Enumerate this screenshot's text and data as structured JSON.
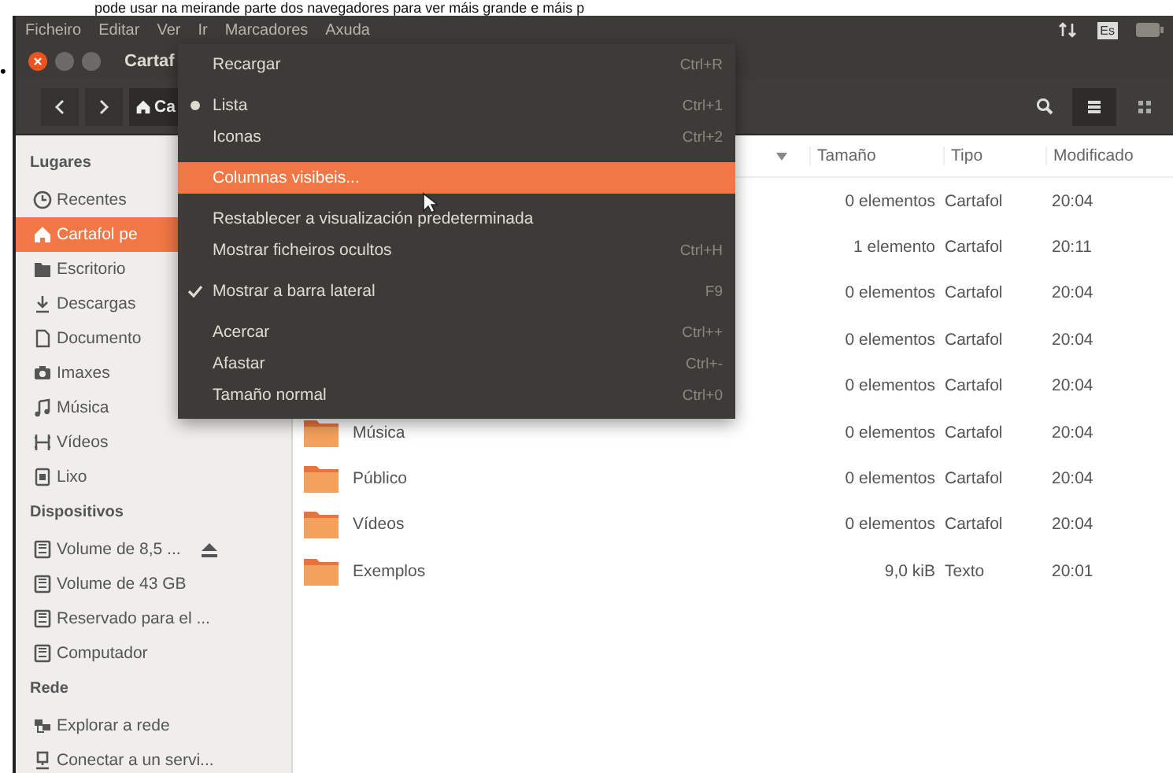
{
  "page_caption": "pode usar na meirande parte dos navegadores para ver máis grande e máis p",
  "bullet": "•",
  "menubar": {
    "items": [
      "Ficheiro",
      "Editar",
      "Ver",
      "Ir",
      "Marcadores",
      "Axuda"
    ],
    "keyboard_layout": "Es"
  },
  "window": {
    "title": "Cartaf"
  },
  "toolbar": {
    "path_button": "Ca",
    "view_buttons": [
      {
        "kind": "list",
        "selected": true
      },
      {
        "kind": "grid",
        "selected": false
      }
    ]
  },
  "sidebar": {
    "sections": [
      {
        "header": "Lugares",
        "items": [
          {
            "label": "Recentes",
            "kind": "clock",
            "selected": false
          },
          {
            "label": "Cartafol pe",
            "kind": "home",
            "selected": true
          },
          {
            "label": "Escritorio",
            "kind": "folder",
            "selected": false
          },
          {
            "label": "Descargas",
            "kind": "download",
            "selected": false
          },
          {
            "label": "Documento",
            "kind": "document",
            "selected": false
          },
          {
            "label": "Imaxes",
            "kind": "camera",
            "selected": false
          },
          {
            "label": "Música",
            "kind": "music",
            "selected": false
          },
          {
            "label": "Vídeos",
            "kind": "film",
            "selected": false
          },
          {
            "label": "Lixo",
            "kind": "trash",
            "selected": false
          }
        ]
      },
      {
        "header": "Dispositivos",
        "items": [
          {
            "label": "Volume de 8,5 ...",
            "kind": "drive",
            "selected": false,
            "eject": true
          },
          {
            "label": "Volume de 43 GB",
            "kind": "drive",
            "selected": false,
            "eject": false
          },
          {
            "label": "Reservado para el ...",
            "kind": "drive",
            "selected": false,
            "eject": false
          },
          {
            "label": "Computador",
            "kind": "drive",
            "selected": false,
            "eject": false
          }
        ]
      },
      {
        "header": "Rede",
        "items": [
          {
            "label": "Explorar a rede",
            "kind": "network",
            "selected": false
          },
          {
            "label": "Conectar a un servi...",
            "kind": "server",
            "selected": false
          }
        ]
      }
    ]
  },
  "file_list": {
    "columns": [
      "Tamaño",
      "Tipo",
      "Modificado"
    ],
    "rows": [
      {
        "size": "0 elementos",
        "type": "Cartafol",
        "modified": "20:04"
      },
      {
        "size": "1 elemento",
        "type": "Cartafol",
        "modified": "20:11"
      },
      {
        "size": "0 elementos",
        "type": "Cartafol",
        "modified": "20:04"
      },
      {
        "size": "0 elementos",
        "type": "Cartafol",
        "modified": "20:04"
      },
      {
        "size": "0 elementos",
        "type": "Cartafol",
        "modified": "20:04"
      },
      {
        "name": "Música",
        "size": "0 elementos",
        "type": "Cartafol",
        "modified": "20:04"
      },
      {
        "name": "Público",
        "size": "0 elementos",
        "type": "Cartafol",
        "modified": "20:04"
      },
      {
        "name": "Vídeos",
        "size": "0 elementos",
        "type": "Cartafol",
        "modified": "20:04"
      },
      {
        "name": "Exemplos",
        "size": "9,0 kiB",
        "type": "Texto",
        "modified": "20:01"
      }
    ]
  },
  "view_menu": {
    "items": [
      {
        "kind": "item",
        "label": "Recargar",
        "shortcut": "Ctrl+R",
        "highlighted": false
      },
      {
        "kind": "separator"
      },
      {
        "kind": "radio",
        "label": "Lista",
        "shortcut": "Ctrl+1",
        "checked": true,
        "highlighted": false
      },
      {
        "kind": "radio",
        "label": "Iconas",
        "shortcut": "Ctrl+2",
        "checked": false,
        "highlighted": false
      },
      {
        "kind": "separator"
      },
      {
        "kind": "item",
        "label": "Columnas visibeis...",
        "highlighted": true
      },
      {
        "kind": "separator"
      },
      {
        "kind": "item",
        "label": "Restablecer a visualización predeterminada",
        "highlighted": false
      },
      {
        "kind": "item",
        "label": "Mostrar ficheiros ocultos",
        "shortcut": "Ctrl+H",
        "highlighted": false
      },
      {
        "kind": "separator"
      },
      {
        "kind": "check",
        "label": "Mostrar a barra lateral",
        "shortcut": "F9",
        "checked": true,
        "highlighted": false
      },
      {
        "kind": "separator"
      },
      {
        "kind": "item",
        "label": "Acercar",
        "shortcut": "Ctrl++",
        "highlighted": false
      },
      {
        "kind": "item",
        "label": "Afastar",
        "shortcut": "Ctrl+-",
        "highlighted": false
      },
      {
        "kind": "item",
        "label": "Tamaño normal",
        "shortcut": "Ctrl+0",
        "highlighted": false
      }
    ]
  }
}
